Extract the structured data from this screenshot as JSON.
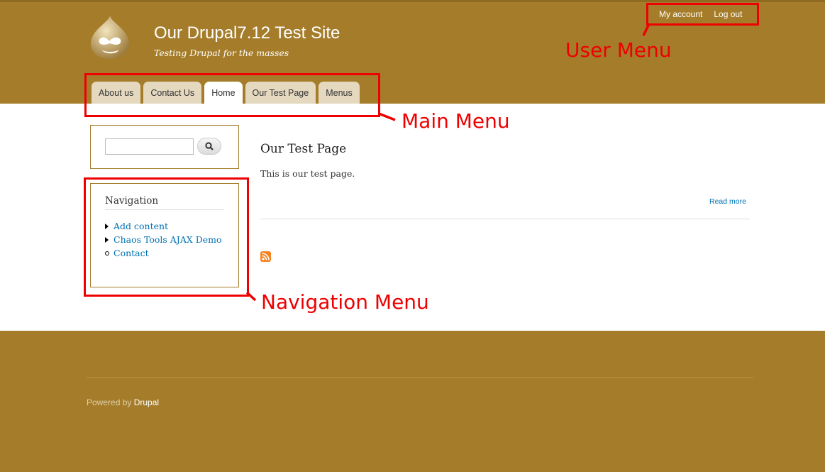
{
  "site": {
    "name": "Our Drupal7.12 Test Site",
    "slogan": "Testing Drupal for the masses"
  },
  "user_menu": {
    "items": [
      "My account",
      "Log out"
    ]
  },
  "main_menu": {
    "tabs": [
      {
        "label": "About us",
        "active": false
      },
      {
        "label": "Contact Us",
        "active": false
      },
      {
        "label": "Home",
        "active": true
      },
      {
        "label": "Our Test Page",
        "active": false
      },
      {
        "label": "Menus",
        "active": false
      }
    ]
  },
  "search": {
    "value": "",
    "icon": "search-icon"
  },
  "navigation": {
    "title": "Navigation",
    "items": [
      {
        "label": "Add content",
        "bullet": "triangle"
      },
      {
        "label": "Chaos Tools AJAX Demo",
        "bullet": "triangle"
      },
      {
        "label": "Contact",
        "bullet": "circle"
      }
    ]
  },
  "node": {
    "title": "Our Test Page",
    "body": "This is our test page.",
    "read_more": "Read more"
  },
  "footer": {
    "powered_prefix": "Powered by ",
    "powered_link": "Drupal"
  },
  "annotations": {
    "user_menu": "User Menu",
    "main_menu": "Main Menu",
    "navigation_menu": "Navigation Menu"
  },
  "colors": {
    "header_bg": "#a57d2a",
    "link": "#0071b3",
    "annotation": "#e00000"
  }
}
